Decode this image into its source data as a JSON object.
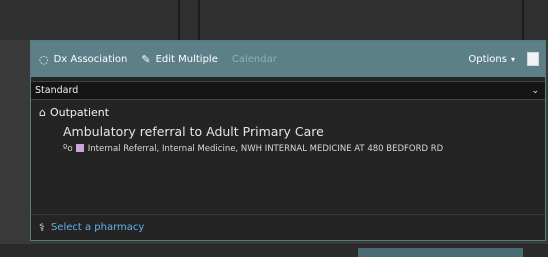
{
  "toolbar": {
    "dx_association": "Dx Association",
    "edit_multiple": "Edit Multiple",
    "calendar": "Calendar",
    "options": "Options",
    "icons": {
      "dx": "circle-icon",
      "edit": "pencil-icon",
      "panel": "panel-toggle-icon"
    }
  },
  "view_select": {
    "value": "Standard"
  },
  "order": {
    "category": "Outpatient",
    "title": "Ambulatory referral to Adult Primary Care",
    "detail": "Internal Referral, Internal Medicine, NWH INTERNAL MEDICINE AT 480 BEDFORD RD",
    "swatch_color": "#c9a6d8"
  },
  "footer": {
    "pharmacy_link": "Select a pharmacy"
  },
  "colors": {
    "toolbar": "#5d8088",
    "link": "#5fb2e8"
  }
}
